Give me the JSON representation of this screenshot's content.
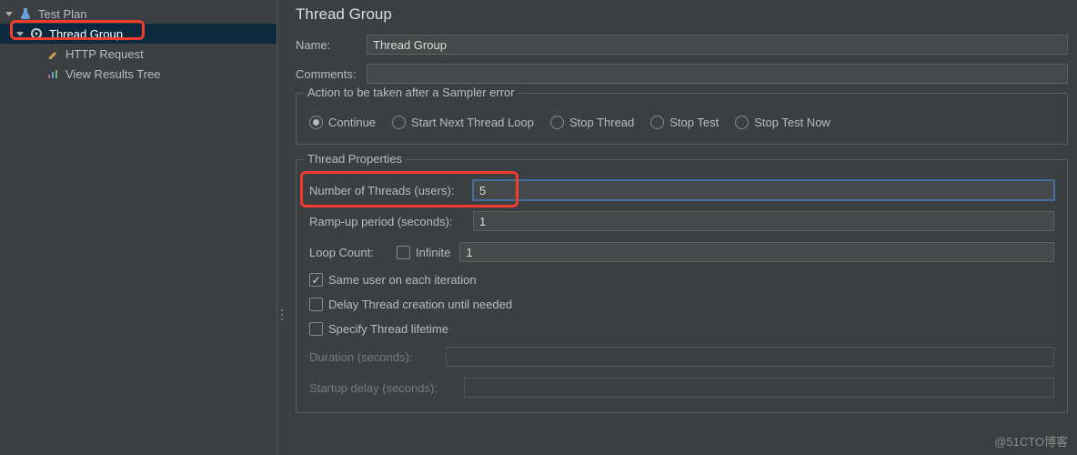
{
  "tree": {
    "test_plan": "Test Plan",
    "thread_group": "Thread Group",
    "http_request": "HTTP Request",
    "view_results": "View Results Tree"
  },
  "panel": {
    "title": "Thread Group",
    "name_label": "Name:",
    "name_value": "Thread Group",
    "comments_label": "Comments:",
    "comments_value": ""
  },
  "sampler_error": {
    "legend": "Action to be taken after a Sampler error",
    "continue": "Continue",
    "start_next": "Start Next Thread Loop",
    "stop_thread": "Stop Thread",
    "stop_test": "Stop Test",
    "stop_now": "Stop Test Now",
    "selected": "continue"
  },
  "thread_props": {
    "legend": "Thread Properties",
    "num_threads_label": "Number of Threads (users):",
    "num_threads_value": "5",
    "ramp_label": "Ramp-up period (seconds):",
    "ramp_value": "1",
    "loop_label": "Loop Count:",
    "loop_infinite": "Infinite",
    "loop_value": "1",
    "same_user": "Same user on each iteration",
    "delay_creation": "Delay Thread creation until needed",
    "specify_lifetime": "Specify Thread lifetime",
    "duration_label": "Duration (seconds):",
    "startup_delay_label": "Startup delay (seconds):"
  },
  "watermark": "@51CTO博客"
}
